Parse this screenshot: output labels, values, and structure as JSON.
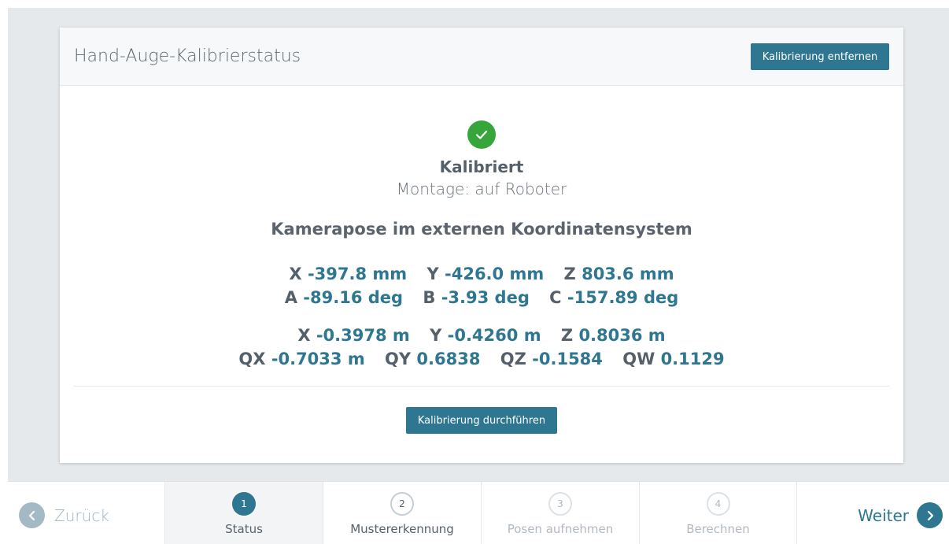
{
  "card": {
    "title": "Hand-Auge-Kalibrierstatus",
    "remove_button": "Kalibrierung entfernen",
    "status": "Kalibriert",
    "mount": "Montage: auf Roboter",
    "pose_heading": "Kamerapose im externen Koordinatensystem",
    "euler_position": [
      {
        "label": "X",
        "value": "-397.8 mm"
      },
      {
        "label": "Y",
        "value": "-426.0 mm"
      },
      {
        "label": "Z",
        "value": "803.6 mm"
      }
    ],
    "euler_rotation": [
      {
        "label": "A",
        "value": "-89.16 deg"
      },
      {
        "label": "B",
        "value": "-3.93 deg"
      },
      {
        "label": "C",
        "value": "-157.89 deg"
      }
    ],
    "quat_position": [
      {
        "label": "X",
        "value": "-0.3978 m"
      },
      {
        "label": "Y",
        "value": "-0.4260 m"
      },
      {
        "label": "Z",
        "value": "0.8036 m"
      }
    ],
    "quat_rotation": [
      {
        "label": "QX",
        "value": "-0.7033 m"
      },
      {
        "label": "QY",
        "value": "0.6838"
      },
      {
        "label": "QZ",
        "value": "-0.1584"
      },
      {
        "label": "QW",
        "value": "0.1129"
      }
    ],
    "run_button": "Kalibrierung durchführen"
  },
  "nav": {
    "back_label": "Zurück",
    "next_label": "Weiter",
    "steps": [
      {
        "num": "1",
        "label": "Status",
        "state": "active"
      },
      {
        "num": "2",
        "label": "Mustererkennung",
        "state": "normal"
      },
      {
        "num": "3",
        "label": "Posen aufnehmen",
        "state": "disabled"
      },
      {
        "num": "4",
        "label": "Berechnen",
        "state": "disabled"
      }
    ]
  },
  "colors": {
    "accent": "#2f7791",
    "success": "#36a53a",
    "text": "#56606b"
  },
  "icons": {
    "status": "check-circle-icon",
    "back": "chevron-left-icon",
    "next": "chevron-right-icon"
  }
}
